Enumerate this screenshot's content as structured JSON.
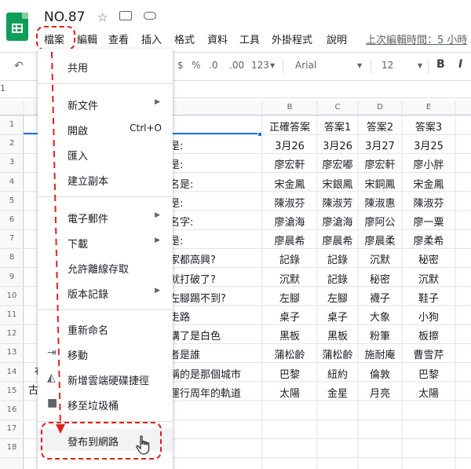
{
  "header": {
    "title": "NO.87",
    "star_icon": "☆",
    "move_icon": "folder-move",
    "cloud_icon": "cloud-status"
  },
  "menubar": {
    "items": [
      "檔案",
      "編輯",
      "查看",
      "插入",
      "格式",
      "資料",
      "工具",
      "外掛程式",
      "說明"
    ],
    "last_edit": "上次編輯時間：5 小時"
  },
  "toolbar": {
    "currency": "$",
    "percent": "%",
    "dec_less": ".0",
    "dec_more": ".00",
    "more_formats": "123",
    "font": "Arial",
    "font_size": "12",
    "bold": "B",
    "italic": "I",
    "cell_ref": "1"
  },
  "file_menu": {
    "share": "共用",
    "new": "新文件",
    "open": "開啟",
    "open_shortcut": "Ctrl+O",
    "import": "匯入",
    "make_copy": "建立副本",
    "email": "電子郵件",
    "download": "下載",
    "offline": "允許離線存取",
    "version_history": "版本記錄",
    "rename": "重新命名",
    "move": "移動",
    "add_shortcut": "新增雲端硬碟捷徑",
    "trash": "移至垃圾桶",
    "publish": "發布到網路"
  },
  "sheet": {
    "columns": [
      "B",
      "C",
      "D",
      "E"
    ],
    "row_numbers": [
      "1",
      "2",
      "3",
      "4",
      "5",
      "6",
      "7",
      "8",
      "9",
      "10",
      "11",
      "12",
      "13",
      "14",
      "15",
      "16",
      "17",
      "18"
    ],
    "col_a_partial": [
      "",
      "是:",
      "是:",
      "名是:",
      "是:",
      "名字:",
      "是:",
      "家都高興?",
      "就打破了?",
      "左腳踢不到?",
      "走路",
      "講了是白色",
      "者是誰",
      "稱的是那個城市",
      "運行周年的軌道"
    ],
    "left_fragments": [
      "布",
      "古"
    ],
    "rows": [
      [
        "正確答案",
        "答案1",
        "答案2",
        "答案3"
      ],
      [
        "3月26",
        "3月26",
        "3月27",
        "3月25"
      ],
      [
        "廖宏軒",
        "廖宏嘟",
        "廖宏軒",
        "廖小胖"
      ],
      [
        "宋金鳳",
        "宋銀鳳",
        "宋銅鳳",
        "宋金鳳"
      ],
      [
        "陳淑芬",
        "陳淑芳",
        "陳淑惠",
        "陳淑芬"
      ],
      [
        "廖滄海",
        "廖滄海",
        "廖阿公",
        "廖一粟"
      ],
      [
        "廖晨希",
        "廖晨希",
        "廖晨柔",
        "廖柔希"
      ],
      [
        "記錄",
        "記錄",
        "沉默",
        "秘密"
      ],
      [
        "沉默",
        "記錄",
        "秘密",
        "沉默"
      ],
      [
        "左腳",
        "左腳",
        "襪子",
        "鞋子"
      ],
      [
        "桌子",
        "桌子",
        "大象",
        "小狗"
      ],
      [
        "黑板",
        "黑板",
        "粉筆",
        "板擦"
      ],
      [
        "蒲松齡",
        "蒲松齡",
        "施耐庵",
        "曹雪芹"
      ],
      [
        "巴黎",
        "紐約",
        "倫敦",
        "巴黎"
      ],
      [
        "太陽",
        "金星",
        "月亮",
        "太陽"
      ]
    ]
  },
  "colors": {
    "brand": "#0f9d58",
    "annotation": "#e0201c",
    "selection": "#1a73e8"
  }
}
